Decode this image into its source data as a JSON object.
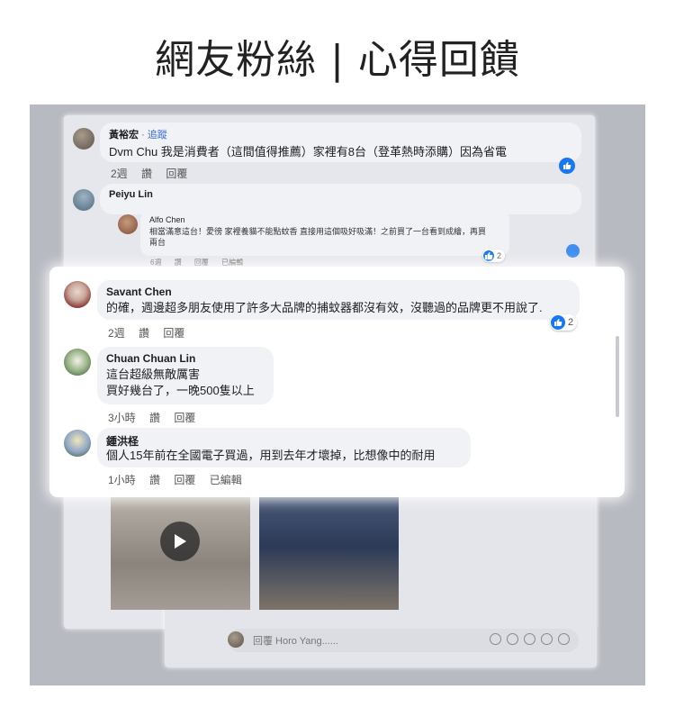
{
  "title": "網友粉絲 | 心得回饋",
  "comments_back": {
    "c1": {
      "author": "黃裕宏",
      "separator": "·",
      "follow": "追蹤",
      "text": "Dvm Chu 我是消費者（這間值得推薦）家裡有8台（登革熱時添購）因為省電",
      "time": "2週",
      "like": "讚",
      "reply": "回覆"
    },
    "c2": {
      "author": "Peiyu Lin"
    },
    "c3": {
      "author": "Alfo Chen",
      "text": "相當滿意這台！愛徬 家裡養貓不能點蚊香 直接用這個吸好吸滿！之前買了一台看到成繪，再買兩台",
      "time": "6週",
      "like": "讚",
      "reply": "回覆",
      "edited": "已編輯",
      "reactions": "2"
    }
  },
  "reply_box": {
    "placeholder": "回覆 Horo Yang......"
  },
  "comments_focus": [
    {
      "author": "Savant Chen",
      "text": "的確，週邊超多朋友使用了許多大品牌的捕蚊器都沒有效，沒聽過的品牌更不用說了.",
      "time": "2週",
      "like": "讚",
      "reply": "回覆",
      "reactions": "2"
    },
    {
      "author": "Chuan Chuan Lin",
      "line1": "這台超級無敵厲害",
      "line2": "買好幾台了，一晚500隻以上",
      "time": "3小時",
      "like": "讚",
      "reply": "回覆"
    },
    {
      "author": "鍾洪柽",
      "text": "個人15年前在全國電子買過，用到去年才壞掉，比想像中的耐用",
      "time": "1小時",
      "like": "讚",
      "reply": "回覆",
      "edited": "已編輯"
    }
  ],
  "colors": {
    "like_blue": "#1877f2",
    "backdrop": "#b8bac2",
    "bubble": "#f1f2f5"
  }
}
